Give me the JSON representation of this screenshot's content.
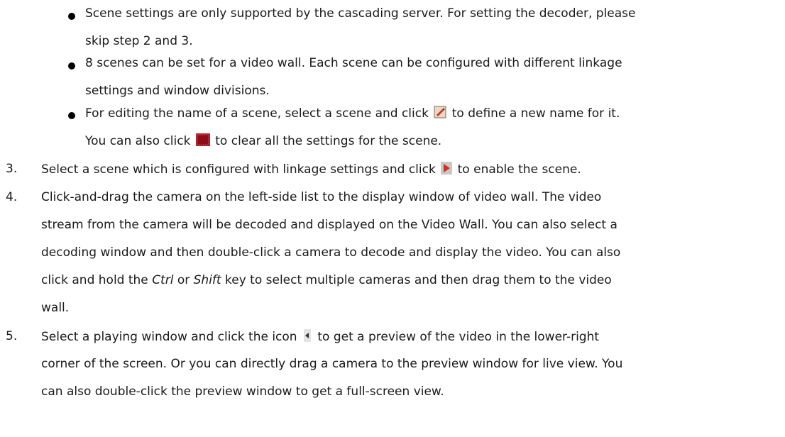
{
  "bullets": [
    {
      "line1": "Scene settings are only supported by the cascading server. For setting the decoder, please",
      "line2": "skip step 2 and 3."
    },
    {
      "line1": "8 scenes can be set for a video wall. Each scene can be configured with different linkage",
      "line2": "settings and window divisions."
    },
    {
      "line1a": "For editing the name of a scene, select a scene and click",
      "line1b": "to define a new name for it.",
      "line2a": "You can also click",
      "line2b": "to clear all the settings for the scene."
    }
  ],
  "steps": [
    {
      "number": "3.",
      "line1a": "Select a scene which is configured with linkage settings and click",
      "line1b": "to enable the scene."
    },
    {
      "number": "4.",
      "line1": "Click-and-drag the camera on the left-side list to the display window of video wall. The video",
      "line2": "stream from the camera will be decoded and displayed on the Video Wall. You can also select a",
      "line3": "decoding window and then double-click a camera to decode and display the video. You can also",
      "line4a": "click and hold the",
      "key1": "Ctrl",
      "line4b": "or",
      "key2": "Shift",
      "line4c": "key to select multiple cameras and then drag them to the video",
      "line5": "wall."
    },
    {
      "number": "5.",
      "line1a": "Select a playing window and click the icon",
      "line1b": "to get a preview of the video in the lower-right",
      "line2": "corner of the screen. Or you can directly drag a camera to the preview window for live view. You",
      "line3": "can also double-click the preview window to get a full-screen view."
    }
  ],
  "icons": {
    "edit": "edit-icon",
    "clear": "clear-icon",
    "play": "play-icon",
    "preview": "preview-arrow-icon"
  }
}
